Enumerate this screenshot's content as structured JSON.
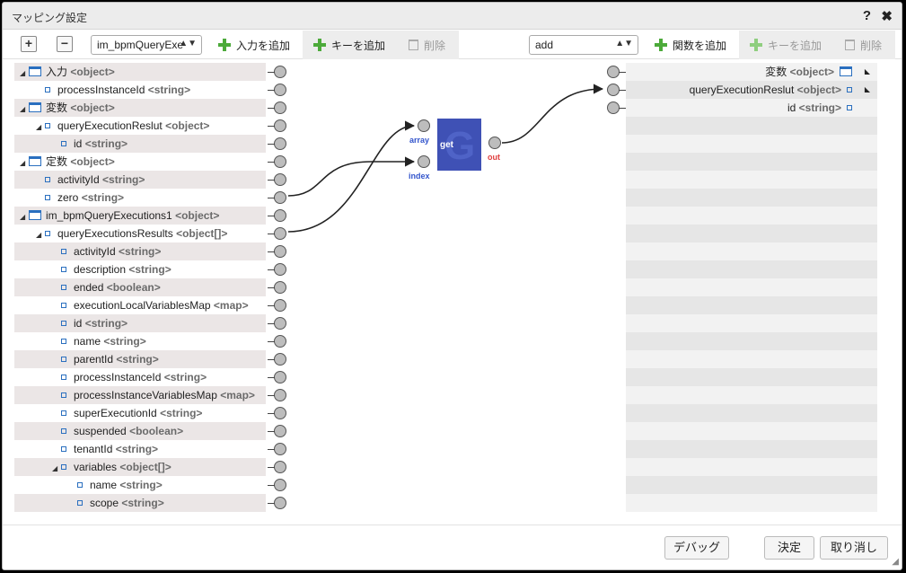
{
  "dialog": {
    "title": "マッピング設定",
    "help": "?",
    "close": "✖"
  },
  "toolbar": {
    "expand": "+",
    "collapse": "−",
    "input_select": "im_bpmQueryExe",
    "add_input": "入力を追加",
    "add_key_left": "キーを追加",
    "delete_left": "削除",
    "function_select": "add",
    "add_function": "関数を追加",
    "add_key_right": "キーを追加",
    "delete_right": "削除"
  },
  "left_tree": [
    {
      "name": "入力",
      "type": "<object>",
      "level": 0,
      "kind": "object",
      "toggle": "◢"
    },
    {
      "name": "processInstanceId",
      "type": "<string>",
      "level": 1,
      "kind": "leaf"
    },
    {
      "name": "変数",
      "type": "<object>",
      "level": 0,
      "kind": "object",
      "toggle": "◢"
    },
    {
      "name": "queryExecutionReslut",
      "type": "<object>",
      "level": 1,
      "kind": "leaf",
      "toggle": "◢"
    },
    {
      "name": "id",
      "type": "<string>",
      "level": 2,
      "kind": "leaf"
    },
    {
      "name": "定数",
      "type": "<object>",
      "level": 0,
      "kind": "object",
      "toggle": "◢"
    },
    {
      "name": "activityId",
      "type": "<string>",
      "level": 1,
      "kind": "leaf"
    },
    {
      "name": "zero",
      "type": "<string>",
      "level": 1,
      "kind": "leaf"
    },
    {
      "name": "im_bpmQueryExecutions1",
      "type": "<object>",
      "level": 0,
      "kind": "object",
      "toggle": "◢"
    },
    {
      "name": "queryExecutionsResults",
      "type": "<object[]>",
      "level": 1,
      "kind": "leaf",
      "toggle": "◢"
    },
    {
      "name": "activityId",
      "type": "<string>",
      "level": 2,
      "kind": "leaf"
    },
    {
      "name": "description",
      "type": "<string>",
      "level": 2,
      "kind": "leaf"
    },
    {
      "name": "ended",
      "type": "<boolean>",
      "level": 2,
      "kind": "leaf"
    },
    {
      "name": "executionLocalVariablesMap",
      "type": "<map>",
      "level": 2,
      "kind": "leaf"
    },
    {
      "name": "id",
      "type": "<string>",
      "level": 2,
      "kind": "leaf"
    },
    {
      "name": "name",
      "type": "<string>",
      "level": 2,
      "kind": "leaf"
    },
    {
      "name": "parentId",
      "type": "<string>",
      "level": 2,
      "kind": "leaf"
    },
    {
      "name": "processInstanceId",
      "type": "<string>",
      "level": 2,
      "kind": "leaf"
    },
    {
      "name": "processInstanceVariablesMap",
      "type": "<map>",
      "level": 2,
      "kind": "leaf"
    },
    {
      "name": "superExecutionId",
      "type": "<string>",
      "level": 2,
      "kind": "leaf"
    },
    {
      "name": "suspended",
      "type": "<boolean>",
      "level": 2,
      "kind": "leaf"
    },
    {
      "name": "tenantId",
      "type": "<string>",
      "level": 2,
      "kind": "leaf"
    },
    {
      "name": "variables",
      "type": "<object[]>",
      "level": 2,
      "kind": "leaf",
      "toggle": "◢"
    },
    {
      "name": "name",
      "type": "<string>",
      "level": 3,
      "kind": "leaf"
    },
    {
      "name": "scope",
      "type": "<string>",
      "level": 3,
      "kind": "leaf"
    }
  ],
  "right_tree": [
    {
      "name": "変数",
      "type": "<object>",
      "kind": "object"
    },
    {
      "name": "queryExecutionReslut",
      "type": "<object>",
      "kind": "leaf"
    },
    {
      "name": "id",
      "type": "<string>",
      "kind": "leaf"
    }
  ],
  "function": {
    "label": "get",
    "ports_in": [
      "array",
      "index"
    ],
    "port_out": "out",
    "colors": {
      "in": "#3355cc",
      "out": "#e04040"
    }
  },
  "footer": {
    "debug": "デバッグ",
    "ok": "決定",
    "cancel": "取り消し"
  }
}
